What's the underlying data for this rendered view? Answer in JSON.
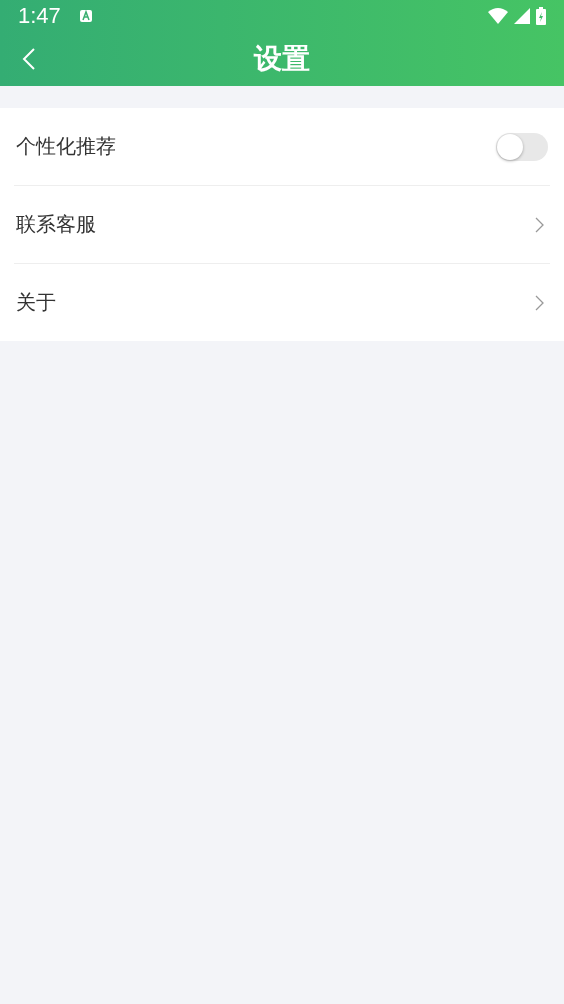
{
  "status_bar": {
    "time": "1:47"
  },
  "header": {
    "title": "设置"
  },
  "settings": [
    {
      "kind": "toggle",
      "label": "个性化推荐",
      "on": false
    },
    {
      "kind": "link",
      "label": "联系客服"
    },
    {
      "kind": "link",
      "label": "关于"
    }
  ]
}
